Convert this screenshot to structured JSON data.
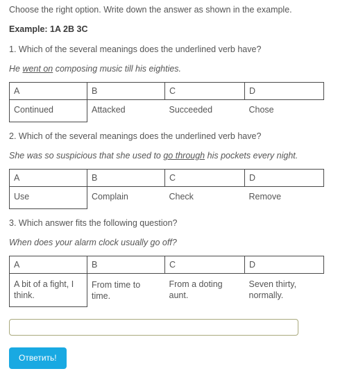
{
  "intro": {
    "instruction": "Choose the right option. Write down the answer as shown in the example.",
    "example": "Example: 1A 2B 3C"
  },
  "questions": [
    {
      "title": "1. Which of the several meanings does the underlined verb have?",
      "sentence_before": "He ",
      "sentence_underlined": "went on",
      "sentence_after": " composing music till his eighties.",
      "headers": [
        "A",
        "B",
        "C",
        "D"
      ],
      "options": [
        "Continued",
        "Attacked",
        "Succeeded",
        "Chose"
      ]
    },
    {
      "title": "2. Which of the several meanings does the underlined verb have?",
      "sentence_before": "She was so suspicious that she used to ",
      "sentence_underlined": "go through",
      "sentence_after": " his pockets every night.",
      "headers": [
        "A",
        "B",
        "C",
        "D"
      ],
      "options": [
        "Use",
        "Complain",
        "Check",
        "Remove"
      ]
    },
    {
      "title": "3. Which answer fits the following question?",
      "sentence_before": "When does your alarm clock usually go off?",
      "sentence_underlined": "",
      "sentence_after": "",
      "headers": [
        "A",
        "B",
        "C",
        "D"
      ],
      "options": [
        "A bit of a fight, I think.",
        "From time to time.",
        "From a doting aunt.",
        "Seven thirty, normally."
      ]
    }
  ],
  "answer": {
    "value": "",
    "placeholder": ""
  },
  "submit": {
    "label": "Ответить!"
  },
  "colors": {
    "accent": "#19a9e2",
    "input_border": "#a9a97d",
    "table_border": "#4a4a4a",
    "text": "#555555"
  }
}
